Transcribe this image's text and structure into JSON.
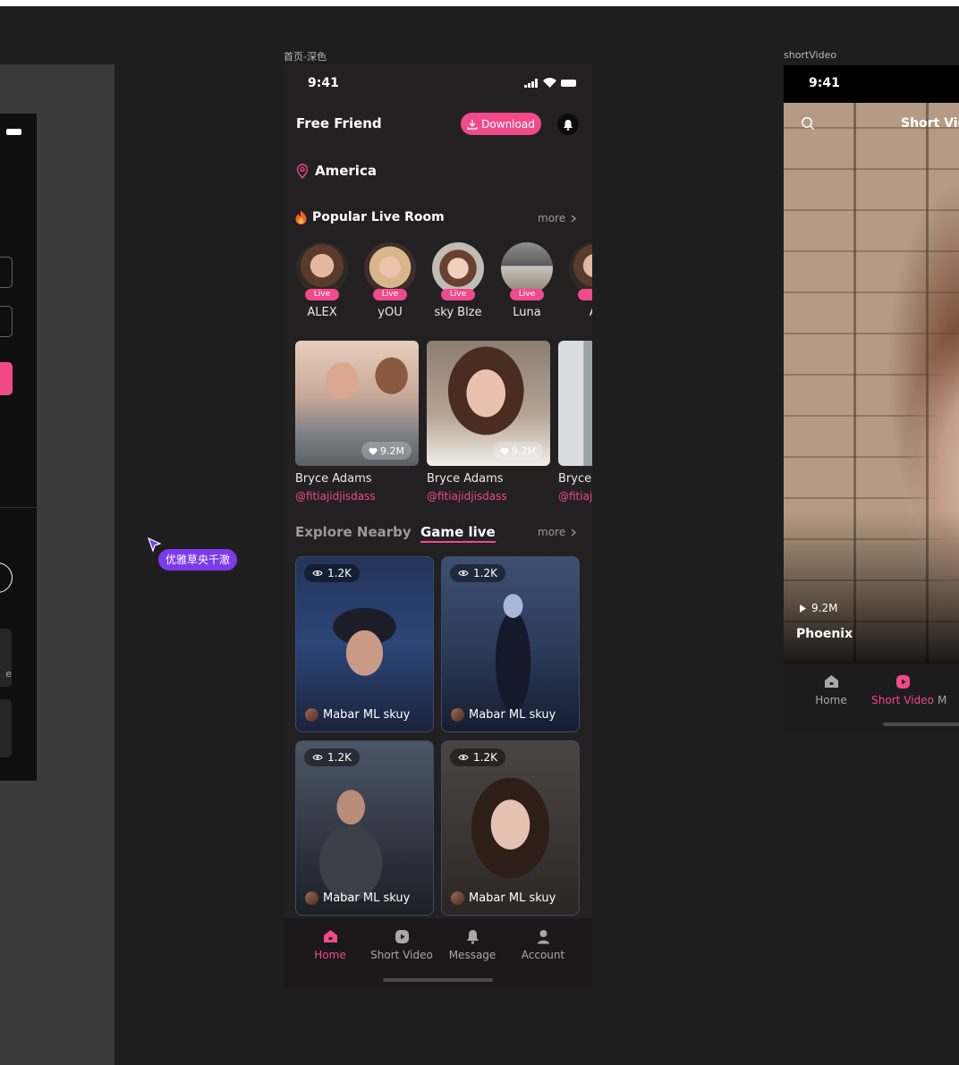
{
  "canvas": {
    "frame_label_main": "首页-深色",
    "frame_label_right": "shortVideo",
    "collaborator": "优雅草央千澈",
    "left_peek_text": "e"
  },
  "status": {
    "time": "9:41"
  },
  "header": {
    "title": "Free Friend",
    "download_label": "Download"
  },
  "location": {
    "name": "America"
  },
  "popular": {
    "title": "Popular Live Room",
    "more": "more",
    "items": [
      {
        "name": "ALEX",
        "badge": "Live"
      },
      {
        "name": "yOU",
        "badge": "Live"
      },
      {
        "name": "sky Blze",
        "badge": "Live"
      },
      {
        "name": "Luna",
        "badge": "Live"
      },
      {
        "name": "Al",
        "badge": "L"
      }
    ]
  },
  "featured": [
    {
      "name": "Bryce Adams",
      "handle": "@fitiajidjisdass",
      "likes": "9.2M"
    },
    {
      "name": "Bryce Adams",
      "handle": "@fitiajidjisdass",
      "likes": "9.2M"
    },
    {
      "name": "Bryce",
      "handle": "@fitiaji",
      "likes": ""
    }
  ],
  "explore": {
    "tab_nearby": "Explore Nearby",
    "tab_game": "Game live",
    "more": "more",
    "cards": [
      {
        "views": "1.2K",
        "streamer": "Mabar ML skuy"
      },
      {
        "views": "1.2K",
        "streamer": "Mabar ML skuy"
      },
      {
        "views": "1.2K",
        "streamer": "Mabar ML skuy"
      },
      {
        "views": "1.2K",
        "streamer": "Mabar ML skuy"
      }
    ]
  },
  "nav": {
    "items": [
      {
        "label": "Home",
        "active": true
      },
      {
        "label": "Short Video",
        "active": false
      },
      {
        "label": "Message",
        "active": false
      },
      {
        "label": "Account",
        "active": false
      }
    ]
  },
  "short_video": {
    "time": "9:41",
    "title": "Short Vid",
    "plays": "9.2M",
    "name": "Phoenix",
    "nav": [
      {
        "label": "Home",
        "active": false
      },
      {
        "label": "Short Video",
        "active": true
      },
      {
        "label": "M",
        "active": false
      }
    ]
  },
  "colors": {
    "accent": "#f04a8b",
    "background": "#232021",
    "collab": "#7c3aed"
  }
}
